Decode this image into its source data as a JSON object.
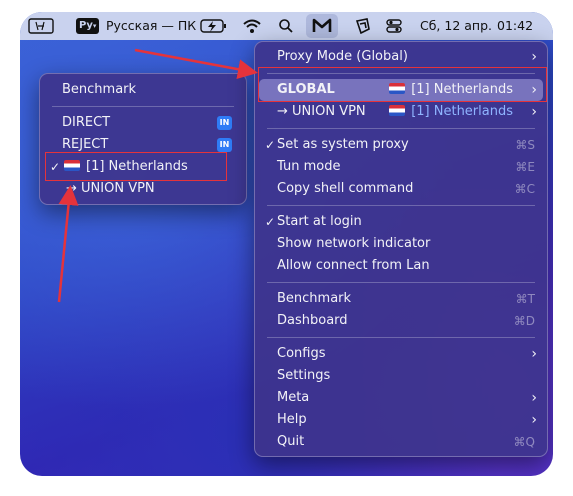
{
  "menubar": {
    "app_badge": "Ру",
    "keyboard_layout": "Русская — ПК",
    "clash_icon_letter": "M",
    "date": "Сб, 12 апр.",
    "time": "01:42"
  },
  "main_menu": {
    "proxy_mode": "Proxy Mode (Global)",
    "global_label": "GLOBAL",
    "global_value": "[1] Netherlands",
    "union_label": "→ UNION VPN",
    "union_value": "[1] Netherlands",
    "set_system_proxy": "Set as system proxy",
    "set_system_proxy_shortcut": "⌘S",
    "tun_mode": "Tun mode",
    "tun_mode_shortcut": "⌘E",
    "copy_shell": "Copy shell command",
    "copy_shell_shortcut": "⌘C",
    "start_at_login": "Start at login",
    "show_network_indicator": "Show network indicator",
    "allow_lan": "Allow connect from Lan",
    "benchmark": "Benchmark",
    "benchmark_shortcut": "⌘T",
    "dashboard": "Dashboard",
    "dashboard_shortcut": "⌘D",
    "configs": "Configs",
    "settings": "Settings",
    "meta": "Meta",
    "help": "Help",
    "quit": "Quit",
    "quit_shortcut": "⌘Q",
    "checkmark": "✓",
    "chevron": "›"
  },
  "sub_menu": {
    "benchmark": "Benchmark",
    "direct": "DIRECT",
    "reject": "REJECT",
    "in_badge": "IN",
    "netherlands": "[1] Netherlands",
    "union_vpn": "→ UNION VPN",
    "checkmark": "✓"
  },
  "colors": {
    "annotation_red": "#e5333b",
    "badge_blue": "#2f7cf6",
    "highlight_text_blue": "#8fb4ff"
  }
}
